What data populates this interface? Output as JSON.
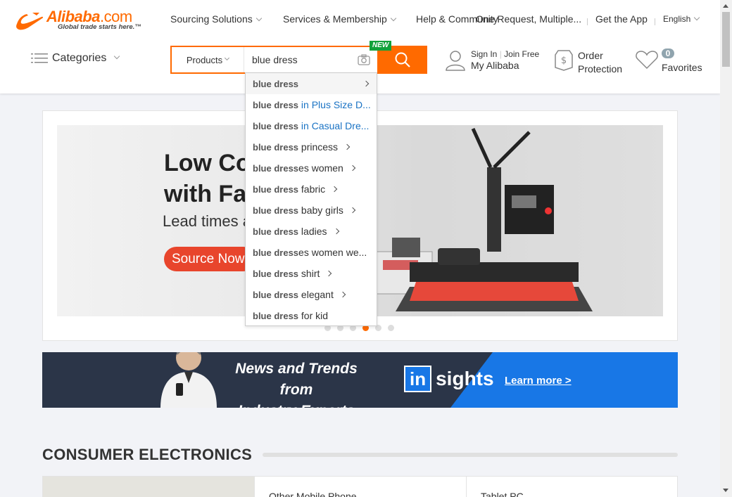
{
  "brand": {
    "name": "Alibaba",
    "domain_suffix": ".com",
    "tagline": "Global trade starts here.™",
    "accent_color": "#ff6a00"
  },
  "topnav": {
    "items": [
      "Sourcing Solutions",
      "Services & Membership",
      "Help & Community"
    ],
    "request": "One Request, Multiple...",
    "get_app": "Get the App",
    "language": "English"
  },
  "categories": {
    "label": "Categories",
    "icon": "list-icon"
  },
  "search": {
    "type": "Products",
    "value": "blue dress",
    "new_badge": "NEW",
    "camera_icon": "camera-icon",
    "button_icon": "search-icon"
  },
  "account": {
    "sign_in": "Sign In",
    "join_free": "Join Free",
    "my_alibaba": "My Alibaba",
    "icon": "user-icon"
  },
  "order_protection": {
    "line1": "Order",
    "line2": "Protection",
    "icon": "shield-dollar-icon"
  },
  "favorites": {
    "count": "0",
    "label": "Favorites",
    "icon": "heart-icon"
  },
  "suggestions": [
    {
      "term": "blue dress",
      "rest": "",
      "style": "plain",
      "arrow": true
    },
    {
      "term": "blue dress",
      "rest": " in Plus Size D...",
      "style": "blue",
      "arrow": false
    },
    {
      "term": "blue dress",
      "rest": " in Casual Dre...",
      "style": "blue",
      "arrow": false
    },
    {
      "term": "blue dress",
      "rest": " princess",
      "style": "plain",
      "arrow": true
    },
    {
      "term": "blue dress",
      "rest": "es women",
      "style": "plain",
      "arrow": true
    },
    {
      "term": "blue dress",
      "rest": " fabric",
      "style": "plain",
      "arrow": true
    },
    {
      "term": "blue dress",
      "rest": " baby girls",
      "style": "plain",
      "arrow": true
    },
    {
      "term": "blue dress",
      "rest": " ladies",
      "style": "plain",
      "arrow": true
    },
    {
      "term": "blue dress",
      "rest": "es women we...",
      "style": "plain",
      "arrow": false
    },
    {
      "term": "blue dress",
      "rest": " shirt",
      "style": "plain",
      "arrow": true
    },
    {
      "term": "blue dress",
      "rest": " elegant",
      "style": "plain",
      "arrow": true
    },
    {
      "term": "blue dress",
      "rest": " for kid",
      "style": "plain",
      "arrow": false
    }
  ],
  "hero": {
    "title_line1": "Low Cost Delivery",
    "title_line2": "with Fast",
    "subtitle": "Lead times and",
    "cta": "Source Now",
    "active_slide": 4,
    "slide_count": 6
  },
  "insights": {
    "headline_line1": "News and Trends from",
    "headline_line2": "Industry Experts",
    "logo_in": "in",
    "logo_sights": "sights",
    "link": "Learn more >"
  },
  "section": {
    "title": "CONSUMER ELECTRONICS",
    "cells": [
      "Other Mobile Phone",
      "Tablet PC"
    ]
  }
}
